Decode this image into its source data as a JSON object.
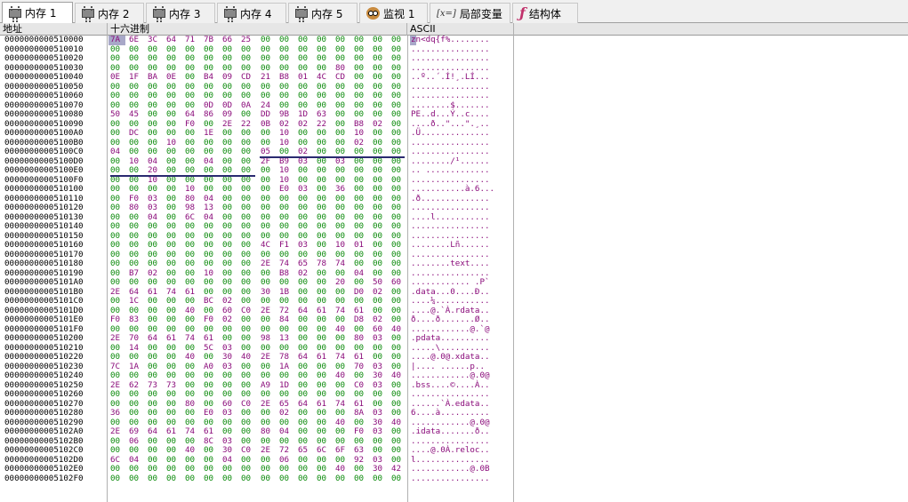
{
  "tabs": [
    {
      "label": "内存 1",
      "icon": "memory-chip-icon",
      "active": true
    },
    {
      "label": "内存 2",
      "icon": "memory-chip-icon"
    },
    {
      "label": "内存 3",
      "icon": "memory-chip-icon"
    },
    {
      "label": "内存 4",
      "icon": "memory-chip-icon"
    },
    {
      "label": "内存 5",
      "icon": "memory-chip-icon"
    },
    {
      "label": "监视 1",
      "icon": "owl-watch-icon"
    },
    {
      "label": "局部变量",
      "icon": "variable-x-icon",
      "prefix": "[x=]"
    },
    {
      "label": "结构体",
      "icon": "struct-fx-icon"
    }
  ],
  "columns": {
    "address": "地址",
    "hex": "十六进制",
    "ascii": "ASCII"
  },
  "rows": [
    {
      "addr": "0000000000510000",
      "hex": "7A 6E 3C 64 71 7B 66 25 00 00 00 00 00 00 00 00",
      "ascii": "zn<dq{f%........"
    },
    {
      "addr": "0000000000510010",
      "hex": "00 00 00 00 00 00 00 00 00 00 00 00 00 00 00 00",
      "ascii": "................"
    },
    {
      "addr": "0000000000510020",
      "hex": "00 00 00 00 00 00 00 00 00 00 00 00 00 00 00 00",
      "ascii": "................"
    },
    {
      "addr": "0000000000510030",
      "hex": "00 00 00 00 00 00 00 00 00 00 00 00 80 00 00 00",
      "ascii": "................"
    },
    {
      "addr": "0000000000510040",
      "hex": "0E 1F BA 0E 00 B4 09 CD 21 B8 01 4C CD 00 00 00",
      "ascii": "..º..´.Í!¸.LÍ..."
    },
    {
      "addr": "0000000000510050",
      "hex": "00 00 00 00 00 00 00 00 00 00 00 00 00 00 00 00",
      "ascii": "................"
    },
    {
      "addr": "0000000000510060",
      "hex": "00 00 00 00 00 00 00 00 00 00 00 00 00 00 00 00",
      "ascii": "................"
    },
    {
      "addr": "0000000000510070",
      "hex": "00 00 00 00 00 0D 0D 0A 24 00 00 00 00 00 00 00",
      "ascii": "........$......."
    },
    {
      "addr": "0000000000510080",
      "hex": "50 45 00 00 64 86 09 00 DD 9B 1D 63 00 00 00 00",
      "ascii": "PE..d...Ý..c...."
    },
    {
      "addr": "0000000000510090",
      "hex": "00 00 00 00 F0 00 2E 22 0B 02 02 22 00 B8 02 00",
      "ascii": "....ð..\"...\".¸.."
    },
    {
      "addr": "00000000005100A0",
      "hex": "00 DC 00 00 00 1E 00 00 00 10 00 00 00 10 00 00",
      "ascii": ".Ü.............."
    },
    {
      "addr": "00000000005100B0",
      "hex": "00 00 00 10 00 00 00 00 00 10 00 00 00 02 00 00",
      "ascii": "................"
    },
    {
      "addr": "00000000005100C0",
      "hex": "04 00 00 00 00 00 00 00 05 00 02 00 00 00 00 00",
      "ascii": "................"
    },
    {
      "addr": "00000000005100D0",
      "hex": "00 10 04 00 00 04 00 00 2F B9 03 00 03 00 00 00",
      "ascii": "......../¹......"
    },
    {
      "addr": "00000000005100E0",
      "hex": "00 00 20 00 00 00 00 00 00 10 00 00 00 00 00 00",
      "ascii": ".. ............."
    },
    {
      "addr": "00000000005100F0",
      "hex": "00 00 10 00 00 00 00 00 00 10 00 00 00 00 00 00",
      "ascii": "................"
    },
    {
      "addr": "0000000000510100",
      "hex": "00 00 00 00 10 00 00 00 00 E0 03 00 36 00 00 00",
      "ascii": "...........à.6..."
    },
    {
      "addr": "0000000000510110",
      "hex": "00 F0 03 00 80 04 00 00 00 00 00 00 00 00 00 00",
      "ascii": ".ð.............."
    },
    {
      "addr": "0000000000510120",
      "hex": "00 80 03 00 98 13 00 00 00 00 00 00 00 00 00 00",
      "ascii": "................"
    },
    {
      "addr": "0000000000510130",
      "hex": "00 00 04 00 6C 04 00 00 00 00 00 00 00 00 00 00",
      "ascii": "....l..........."
    },
    {
      "addr": "0000000000510140",
      "hex": "00 00 00 00 00 00 00 00 00 00 00 00 00 00 00 00",
      "ascii": "................"
    },
    {
      "addr": "0000000000510150",
      "hex": "00 00 00 00 00 00 00 00 00 00 00 00 00 00 00 00",
      "ascii": "................"
    },
    {
      "addr": "0000000000510160",
      "hex": "00 00 00 00 00 00 00 00 4C F1 03 00 10 01 00 00",
      "ascii": "........Lñ......"
    },
    {
      "addr": "0000000000510170",
      "hex": "00 00 00 00 00 00 00 00 00 00 00 00 00 00 00 00",
      "ascii": "................"
    },
    {
      "addr": "0000000000510180",
      "hex": "00 00 00 00 00 00 00 00 2E 74 65 78 74 00 00 00",
      "ascii": "........text...."
    },
    {
      "addr": "0000000000510190",
      "hex": "00 B7 02 00 00 10 00 00 00 B8 02 00 00 04 00 00",
      "ascii": "................"
    },
    {
      "addr": "00000000005101A0",
      "hex": "00 00 00 00 00 00 00 00 00 00 00 00 20 00 50 60",
      "ascii": "............ .P`"
    },
    {
      "addr": "00000000005101B0",
      "hex": "2E 64 61 74 61 00 00 00 30 1B 00 00 00 D0 02 00",
      "ascii": ".data...0....Ð.."
    },
    {
      "addr": "00000000005101C0",
      "hex": "00 1C 00 00 00 BC 02 00 00 00 00 00 00 00 00 00",
      "ascii": "....¼..........."
    },
    {
      "addr": "00000000005101D0",
      "hex": "00 00 00 00 40 00 60 C0 2E 72 64 61 74 61 00 00",
      "ascii": "....@.`À.rdata.."
    },
    {
      "addr": "00000000005101E0",
      "hex": "F0 83 00 00 00 F0 02 00 00 84 00 00 00 D8 02 00",
      "ascii": "ð....ð.......Ø.."
    },
    {
      "addr": "00000000005101F0",
      "hex": "00 00 00 00 00 00 00 00 00 00 00 00 40 00 60 40",
      "ascii": "............@.`@"
    },
    {
      "addr": "0000000000510200",
      "hex": "2E 70 64 61 74 61 00 00 98 13 00 00 00 80 03 00",
      "ascii": ".pdata.........."
    },
    {
      "addr": "0000000000510210",
      "hex": "00 14 00 00 00 5C 03 00 00 00 00 00 00 00 00 00",
      "ascii": ".....\\.........."
    },
    {
      "addr": "0000000000510220",
      "hex": "00 00 00 00 40 00 30 40 2E 78 64 61 74 61 00 00",
      "ascii": "....@.0@.xdata.."
    },
    {
      "addr": "0000000000510230",
      "hex": "7C 1A 00 00 00 A0 03 00 00 1A 00 00 00 70 03 00",
      "ascii": "|.... ......p.."
    },
    {
      "addr": "0000000000510240",
      "hex": "00 00 00 00 00 00 00 00 00 00 00 00 40 00 30 40",
      "ascii": "............@.0@"
    },
    {
      "addr": "0000000000510250",
      "hex": "2E 62 73 73 00 00 00 00 A9 1D 00 00 00 C0 03 00",
      "ascii": ".bss....©....À.."
    },
    {
      "addr": "0000000000510260",
      "hex": "00 00 00 00 00 00 00 00 00 00 00 00 00 00 00 00",
      "ascii": "................"
    },
    {
      "addr": "0000000000510270",
      "hex": "00 00 00 00 80 00 60 C0 2E 65 64 61 74 61 00 00",
      "ascii": "......`À.edata.."
    },
    {
      "addr": "0000000000510280",
      "hex": "36 00 00 00 00 E0 03 00 00 02 00 00 00 8A 03 00",
      "ascii": "6....à.........."
    },
    {
      "addr": "0000000000510290",
      "hex": "00 00 00 00 00 00 00 00 00 00 00 00 40 00 30 40",
      "ascii": "............@.0@"
    },
    {
      "addr": "00000000005102A0",
      "hex": "2E 69 64 61 74 61 00 00 80 04 00 00 00 F0 03 00",
      "ascii": ".idata.......ð.."
    },
    {
      "addr": "00000000005102B0",
      "hex": "00 06 00 00 00 8C 03 00 00 00 00 00 00 00 00 00",
      "ascii": "................"
    },
    {
      "addr": "00000000005102C0",
      "hex": "00 00 00 00 40 00 30 C0 2E 72 65 6C 6F 63 00 00",
      "ascii": "....@.0À.reloc.."
    },
    {
      "addr": "00000000005102D0",
      "hex": "6C 04 00 00 00 00 04 00 00 06 00 00 00 92 03 00",
      "ascii": "l..............."
    },
    {
      "addr": "00000000005102E0",
      "hex": "00 00 00 00 00 00 00 00 00 00 00 00 40 00 30 42",
      "ascii": "............@.0B"
    },
    {
      "addr": "00000000005102F0",
      "hex": "00 00 00 00 00 00 00 00 00 00 00 00 00 00 00 00",
      "ascii": "................"
    }
  ]
}
